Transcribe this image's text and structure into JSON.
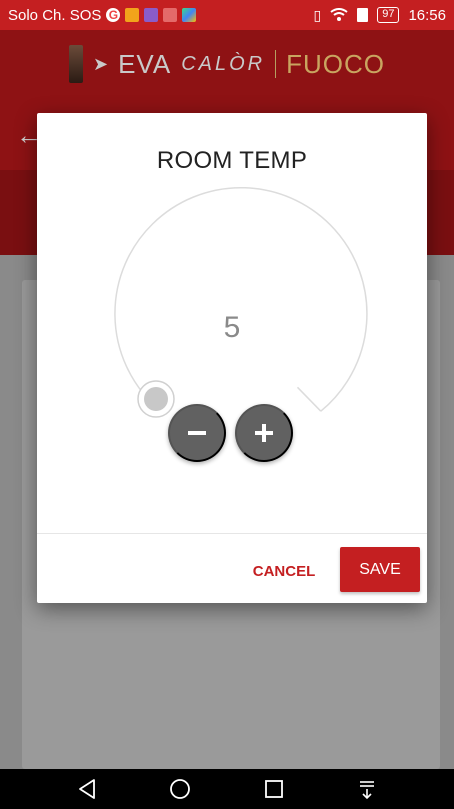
{
  "status_bar": {
    "carrier": "Solo Ch. SOS",
    "battery": "97",
    "time": "16:56",
    "icons": [
      "google-icon",
      "app-orange-icon",
      "app-purple-icon",
      "calendar-icon",
      "play-store-icon"
    ]
  },
  "app_bar": {
    "brand_eva": "EVA",
    "brand_calor": "CALÒR",
    "brand_fuoco": "FUOCO"
  },
  "dialog": {
    "title": "ROOM TEMP",
    "value": "5",
    "cancel_label": "CANCEL",
    "save_label": "SAVE"
  },
  "colors": {
    "primary": "#c41f21",
    "button_gray": "#616161"
  }
}
